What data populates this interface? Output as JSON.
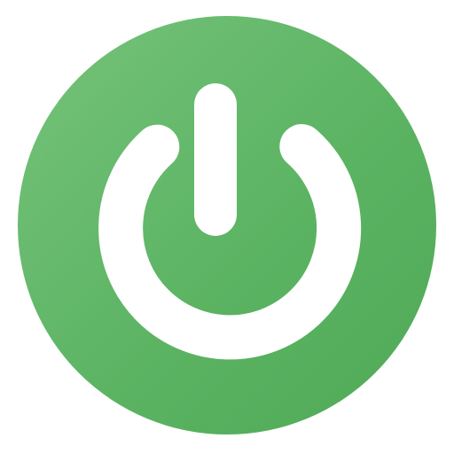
{
  "icon": {
    "name": "power-icon",
    "background_color_light": "#76c27b",
    "background_color": "#5cb463",
    "background_color_dark": "#4ea956",
    "glyph_color": "#ffffff"
  }
}
